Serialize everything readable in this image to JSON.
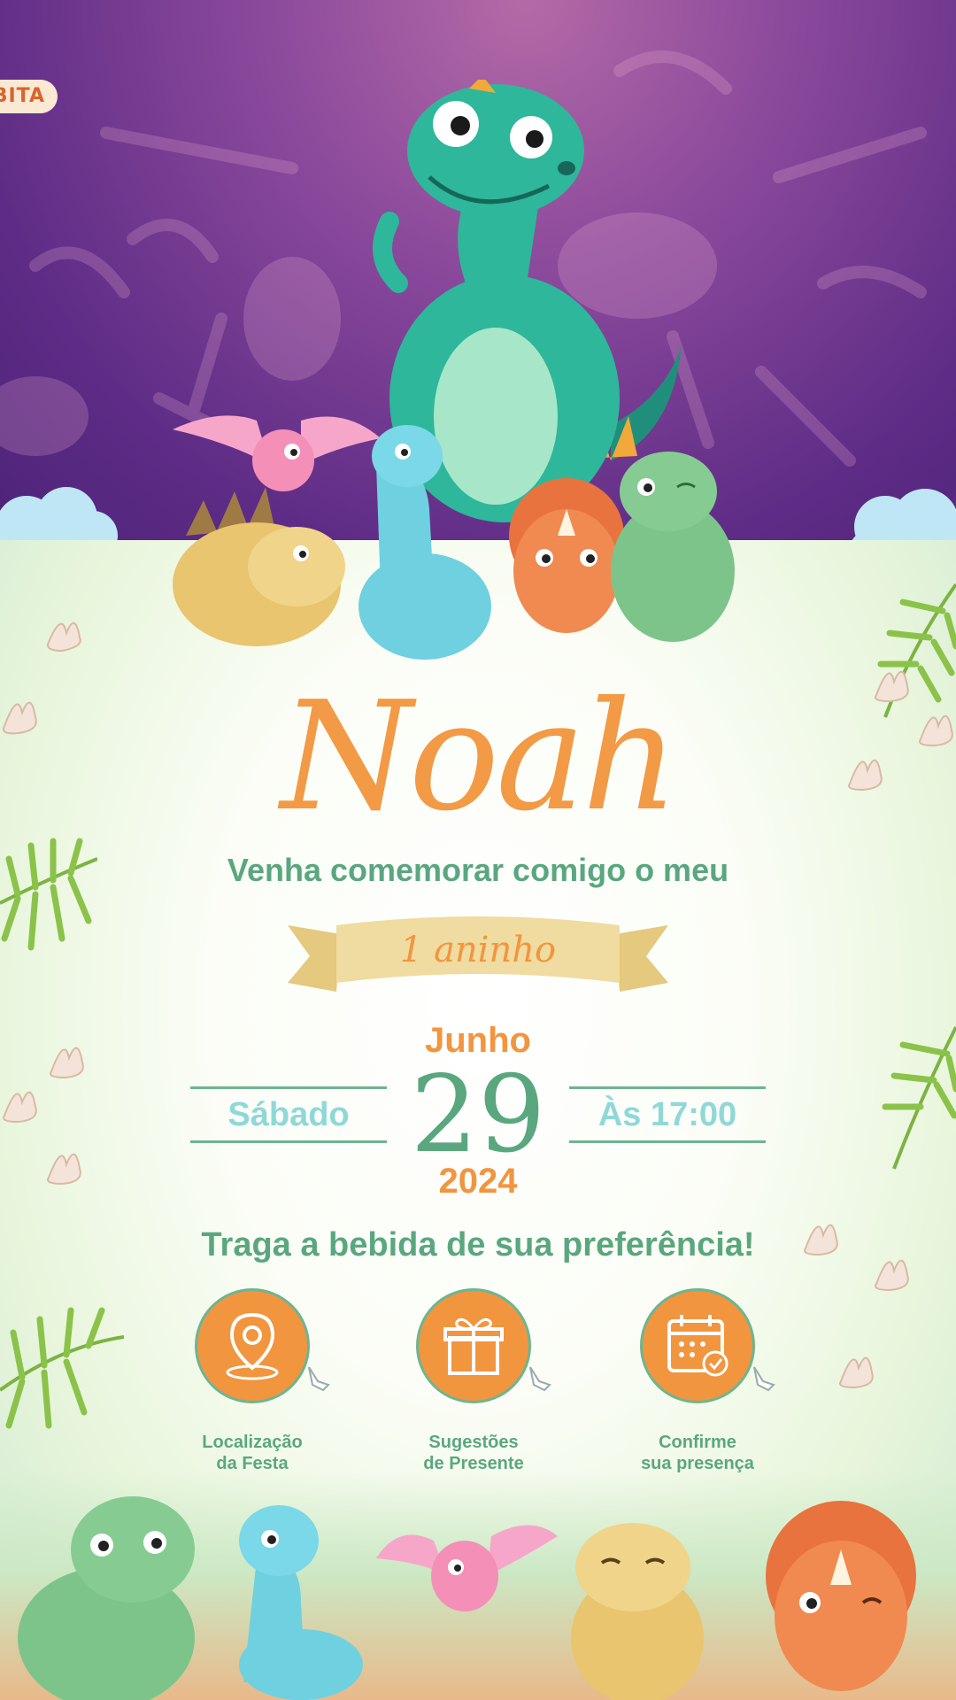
{
  "badge": {
    "text": "BITA"
  },
  "name": "Noah",
  "invite_line": "Venha comemorar comigo o meu",
  "age_ribbon": "1 aninho",
  "date": {
    "month": "Junho",
    "day": "29",
    "year": "2024",
    "weekday": "Sábado",
    "time": "Às 17:00"
  },
  "drink_note": "Traga a bebida de sua preferência!",
  "actions": [
    {
      "label": "Localização\nda Festa",
      "icon": "map-pin-icon"
    },
    {
      "label": "Sugestões\nde Presente",
      "icon": "gift-icon"
    },
    {
      "label": "Confirme\nsua presença",
      "icon": "calendar-check-icon"
    }
  ],
  "colors": {
    "orange": "#f2953f",
    "green": "#5aa77f",
    "aqua": "#8fd8d8",
    "purple": "#5e2c86",
    "ribbon": "#f0dba0"
  }
}
